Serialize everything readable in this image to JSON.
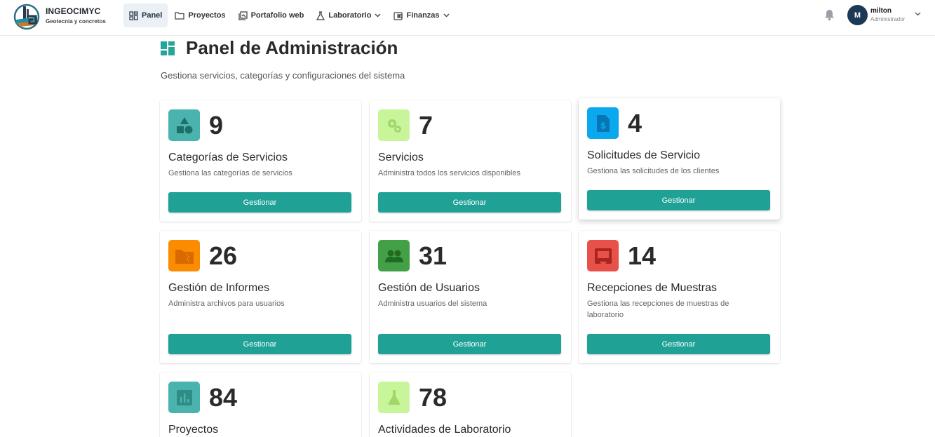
{
  "brand": {
    "name": "INGEOCIMYC",
    "tagline": "Geotecnia y concretos"
  },
  "nav": [
    {
      "label": "Panel",
      "icon": "dashboard-icon"
    },
    {
      "label": "Proyectos",
      "icon": "folder-icon"
    },
    {
      "label": "Portafolio web",
      "icon": "portfolio-icon"
    },
    {
      "label": "Laboratorio",
      "icon": "flask-icon"
    },
    {
      "label": "Finanzas",
      "icon": "finance-icon"
    }
  ],
  "user": {
    "initial": "M",
    "name": "milton",
    "role": "Administrador"
  },
  "page": {
    "title": "Panel de Administración",
    "subtitle": "Gestiona servicios, categorías y configuraciones del sistema"
  },
  "colors": {
    "accent": "#20a196",
    "header_icon": "#26a69a"
  },
  "cards": [
    {
      "count": "9",
      "title": "Categorías de Servicios",
      "description": "Gestiona las categorías de servicios",
      "button": "Gestionar",
      "icon": "shapes-icon",
      "color": "#4ab3ad"
    },
    {
      "count": "7",
      "title": "Servicios",
      "description": "Administra todos los servicios disponibles",
      "button": "Gestionar",
      "icon": "gears-icon",
      "color": "#c8f59a"
    },
    {
      "count": "4",
      "title": "Solicitudes de Servicio",
      "description": "Gestiona las solicitudes de los clientes",
      "button": "Gestionar",
      "icon": "request-doc-icon",
      "color": "#0aa8ee"
    },
    {
      "count": "26",
      "title": "Gestión de Informes",
      "description": "Administra archivos para usuarios",
      "button": "Gestionar",
      "icon": "folder-zip-icon",
      "color": "#fb8c00"
    },
    {
      "count": "31",
      "title": "Gestión de Usuarios",
      "description": "Administra usuarios del sistema",
      "button": "Gestionar",
      "icon": "users-icon",
      "color": "#43a047"
    },
    {
      "count": "14",
      "title": "Recepciones de Muestras",
      "description": "Gestiona las recepciones de muestras de laboratorio",
      "button": "Gestionar",
      "icon": "inbox-icon",
      "color": "#e85149"
    },
    {
      "count": "84",
      "title": "Proyectos",
      "description": "",
      "button": "",
      "icon": "bar-chart-icon",
      "color": "#4ab3ad"
    },
    {
      "count": "78",
      "title": "Actividades de Laboratorio",
      "description": "",
      "button": "",
      "icon": "flask-icon",
      "color": "#c8f59a"
    }
  ]
}
